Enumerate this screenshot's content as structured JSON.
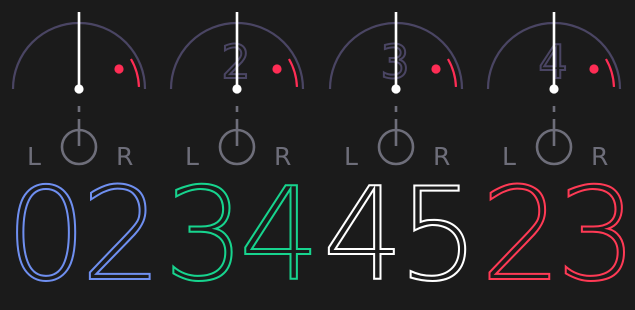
{
  "colors": {
    "background": "#1b1b1b",
    "arc": "#4a4563",
    "needle": "#ffffff",
    "peak": "#ff2d55",
    "pan_knob": "#6e6e7a"
  },
  "pan": {
    "left_label": "L",
    "right_label": "R"
  },
  "channels": [
    {
      "index_label": "",
      "value": "02",
      "value_color": "#6f8ff0",
      "level": 0.5,
      "peak": 0.85
    },
    {
      "index_label": "2",
      "value": "34",
      "value_color": "#17d48e",
      "level": 0.5,
      "peak": 0.85
    },
    {
      "index_label": "3",
      "value": "45",
      "value_color": "#ffffff",
      "level": 0.5,
      "peak": 0.85
    },
    {
      "index_label": "4",
      "value": "23",
      "value_color": "#ff3a55",
      "level": 0.5,
      "peak": 0.85
    }
  ]
}
